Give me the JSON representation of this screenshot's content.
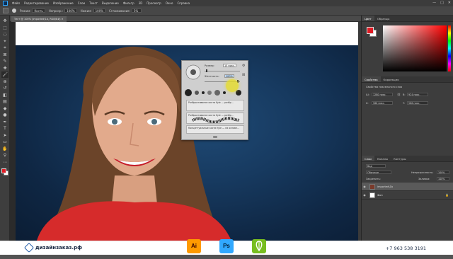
{
  "menubar": {
    "items": [
      "Файл",
      "Редактирование",
      "Изображение",
      "Слои",
      "Текст",
      "Выделение",
      "Фильтр",
      "3D",
      "Просмотр",
      "Окно",
      "Справка"
    ],
    "window_controls": [
      "—",
      "□",
      "✕"
    ]
  },
  "options_bar": {
    "mode_label": "Режим:",
    "mode_value": "Кисть",
    "opacity_label": "Непрозр.:",
    "opacity_value": "100%",
    "pressure_label": "Нажим:",
    "pressure_value": "100%",
    "smoothing_label": "Сглаживание:",
    "smoothing_value": "5%"
  },
  "document": {
    "tab_title": "Тест @ 100% (imported\\1b, RGB/8#) ✕"
  },
  "toolbar": {
    "tools": [
      {
        "name": "move-tool-icon",
        "glyph": "✥"
      },
      {
        "name": "marquee-tool-icon",
        "glyph": "⬚"
      },
      {
        "name": "lasso-tool-icon",
        "glyph": "◌"
      },
      {
        "name": "quick-select-tool-icon",
        "glyph": "⌖"
      },
      {
        "name": "crop-tool-icon",
        "glyph": "⌗"
      },
      {
        "name": "frame-tool-icon",
        "glyph": "⊠"
      },
      {
        "name": "eyedropper-tool-icon",
        "glyph": "✎"
      },
      {
        "name": "healing-brush-tool-icon",
        "glyph": "✚"
      },
      {
        "name": "brush-tool-icon",
        "glyph": "🖌"
      },
      {
        "name": "clone-stamp-tool-icon",
        "glyph": "⊕"
      },
      {
        "name": "history-brush-tool-icon",
        "glyph": "↺"
      },
      {
        "name": "eraser-tool-icon",
        "glyph": "◧"
      },
      {
        "name": "gradient-tool-icon",
        "glyph": "▤"
      },
      {
        "name": "blur-tool-icon",
        "glyph": "◆"
      },
      {
        "name": "dodge-tool-icon",
        "glyph": "●"
      },
      {
        "name": "pen-tool-icon",
        "glyph": "✒"
      },
      {
        "name": "type-tool-icon",
        "glyph": "T"
      },
      {
        "name": "path-select-tool-icon",
        "glyph": "➤"
      },
      {
        "name": "shape-tool-icon",
        "glyph": "▭"
      },
      {
        "name": "hand-tool-icon",
        "glyph": "✋"
      },
      {
        "name": "zoom-tool-icon",
        "glyph": "⚲"
      },
      {
        "name": "more-tools-icon",
        "glyph": "⋯"
      }
    ],
    "foreground_color": "#e01b24",
    "background_color": "#ffffff"
  },
  "brush_picker": {
    "size_label": "Размер:",
    "size_value": "15 пикс.",
    "hardness_label": "Жесткость:",
    "hardness_value": "100%",
    "presets": [
      {
        "name": "Разбрызгивание кисти Kyle — разбр..."
      },
      {
        "name": "Разбрызгивание кисти Kyle — разбр..."
      },
      {
        "name": "Концептуальные кисти Kyle — на основе..."
      }
    ]
  },
  "panels": {
    "color_tabs": [
      "Цвет",
      "Образцы"
    ],
    "properties_tabs": [
      "Свойства",
      "Коррекция"
    ],
    "properties_header": "Свойства пиксельного слоя",
    "prop_w_label": "Ш:",
    "prop_w_value": "1280 пикс.",
    "prop_h_label": "В:",
    "prop_h_value": "924 пикс.",
    "prop_x_label": "X:",
    "prop_x_value": "586 пикс.",
    "prop_y_label": "Y:",
    "prop_y_value": "586 пикс.",
    "layers_tabs": [
      "Слои",
      "Каналы",
      "Контуры"
    ],
    "layers_kind": "Вид",
    "blend_mode": "Обычные",
    "opacity_label": "Непрозрачность:",
    "opacity_value": "100%",
    "lock_label": "Закрепить:",
    "fill_label": "Заливка:",
    "fill_value": "100%",
    "layers": [
      {
        "name": "imported\\1b",
        "selected": true
      },
      {
        "name": "Фон",
        "selected": false
      }
    ]
  },
  "footer": {
    "brand": "дизайнзаказ.рф",
    "phone": "+7 963 538 3191",
    "apps": [
      {
        "label": "Ai",
        "bg": "#ff9a00",
        "fg": "#330000"
      },
      {
        "label": "Ps",
        "bg": "#31a8ff",
        "fg": "#001e36"
      },
      {
        "label": "",
        "bg": "#78be20",
        "fg": "#ffffff"
      }
    ]
  },
  "colors": {
    "accent": "#e01b24",
    "ps_blue": "#31a8ff",
    "ai_orange": "#ff9a00",
    "cdr_green": "#78be20"
  }
}
